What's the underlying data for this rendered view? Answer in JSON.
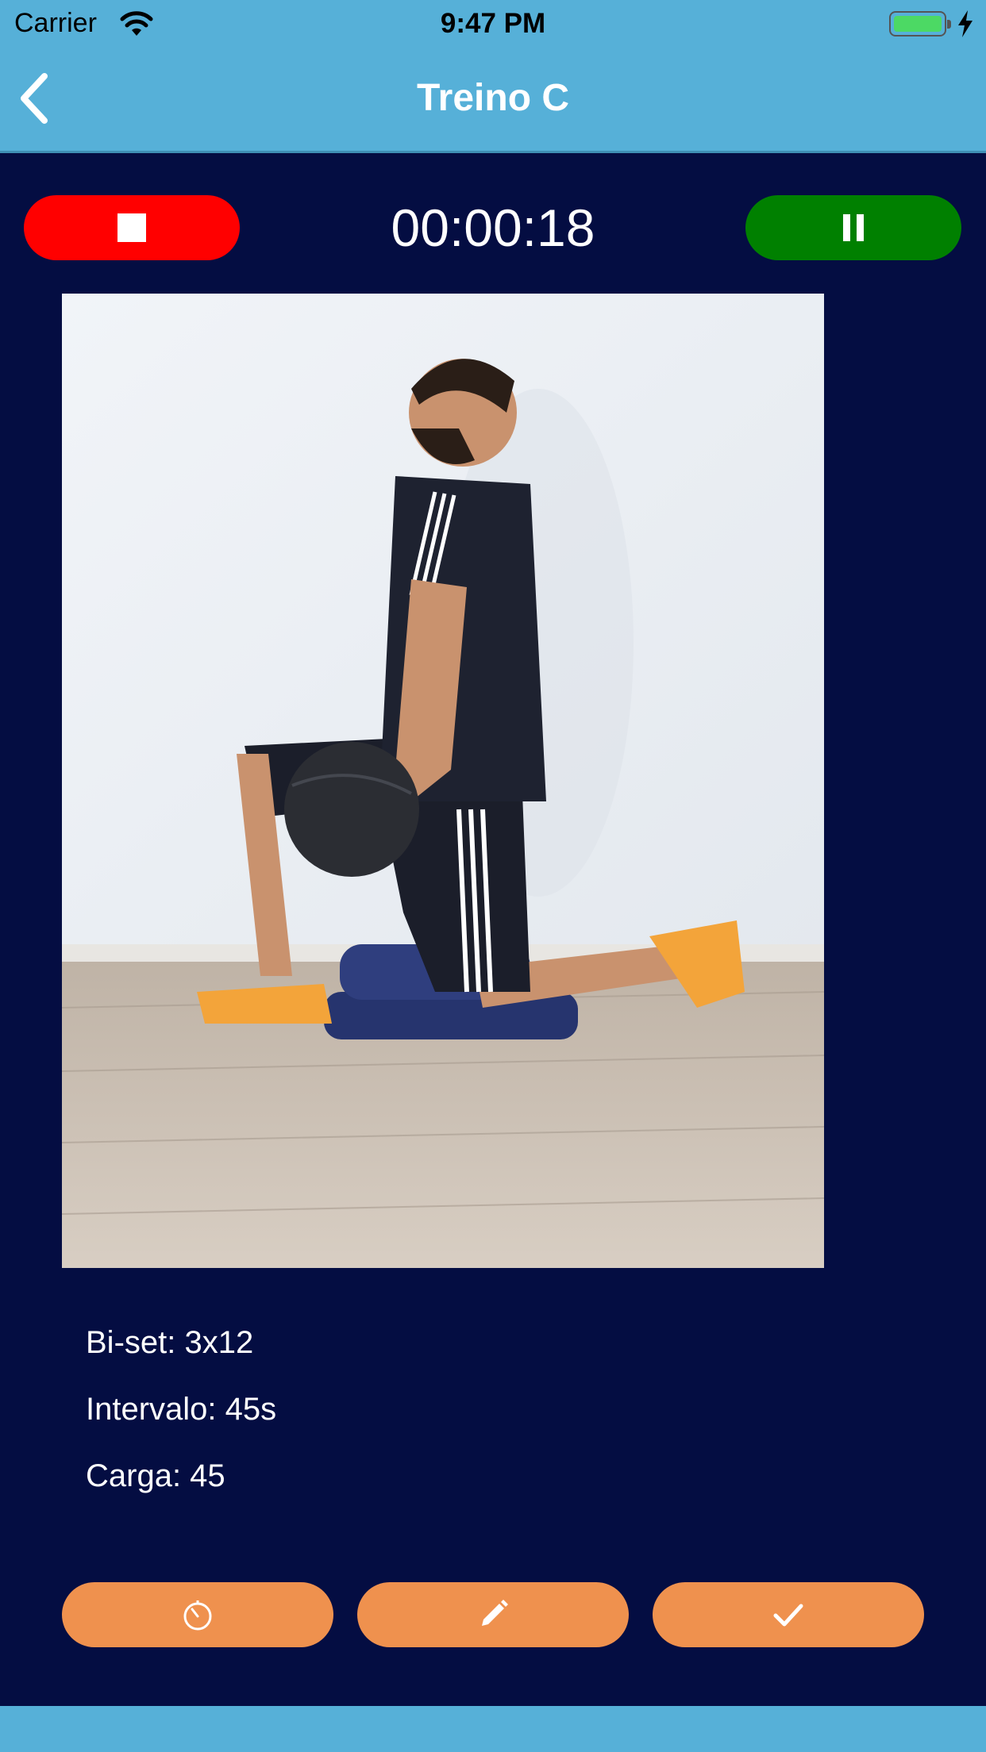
{
  "status_bar": {
    "carrier": "Carrier",
    "time": "9:47 PM",
    "wifi_icon": "wifi-icon",
    "battery_icon": "battery-icon",
    "charging_icon": "bolt-icon"
  },
  "nav": {
    "title": "Treino C",
    "back_icon": "chevron-left-icon"
  },
  "workout": {
    "elapsed": "00:00:18",
    "stop_icon": "stop-icon",
    "pause_icon": "pause-icon"
  },
  "exercise": {
    "image_icon": "exercise-photo",
    "sets": "Bi-set: 3x12",
    "interval": "Intervalo: 45s",
    "load": "Carga: 45"
  },
  "actions": [
    {
      "icon": "stopwatch-icon"
    },
    {
      "icon": "pencil-icon"
    },
    {
      "icon": "checkmark-icon"
    }
  ],
  "colors": {
    "header": "#56B0D8",
    "background": "#040D42",
    "stop": "#FF0000",
    "pause": "#008000",
    "action": "#EF914E"
  }
}
